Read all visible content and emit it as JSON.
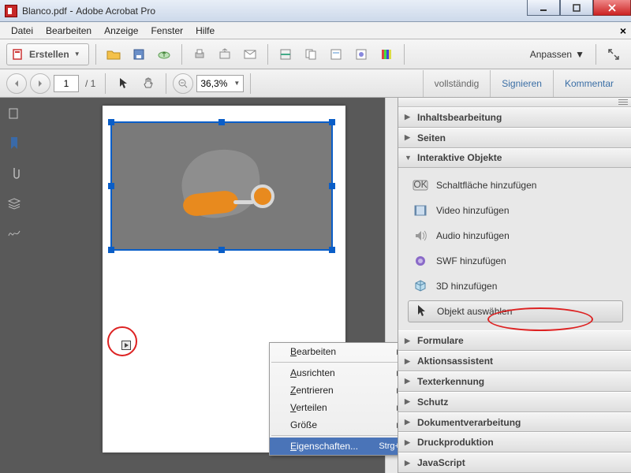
{
  "titlebar": {
    "filename": "Blanco.pdf",
    "appname": "Adobe Acrobat Pro"
  },
  "menu": {
    "items": [
      "Datei",
      "Bearbeiten",
      "Anzeige",
      "Fenster",
      "Hilfe"
    ]
  },
  "toolbar": {
    "create": "Erstellen",
    "anpassen": "Anpassen"
  },
  "nav": {
    "page": "1",
    "pagecount": "/  1",
    "zoom": "36,3%"
  },
  "rightlinks": {
    "a": "vollständig",
    "b": "Signieren",
    "c": "Kommentar"
  },
  "ctx": {
    "bearbeiten": "Bearbeiten",
    "ausrichten": "Ausrichten",
    "zentrieren": "Zentrieren",
    "verteilen": "Verteilen",
    "groesse": "Größe",
    "eigenschaften": "Eigenschaften...",
    "shortcut": "Strg+I"
  },
  "panel": {
    "sec1": "Inhaltsbearbeitung",
    "sec2": "Seiten",
    "sec3": "Interaktive Objekte",
    "tools": {
      "btn": "Schaltfläche hinzufügen",
      "video": "Video hinzufügen",
      "audio": "Audio hinzufügen",
      "swf": "SWF hinzufügen",
      "d3": "3D hinzufügen",
      "select": "Objekt auswählen"
    },
    "sec4": "Formulare",
    "sec5": "Aktionsassistent",
    "sec6": "Texterkennung",
    "sec7": "Schutz",
    "sec8": "Dokumentverarbeitung",
    "sec9": "Druckproduktion",
    "sec10": "JavaScript"
  }
}
